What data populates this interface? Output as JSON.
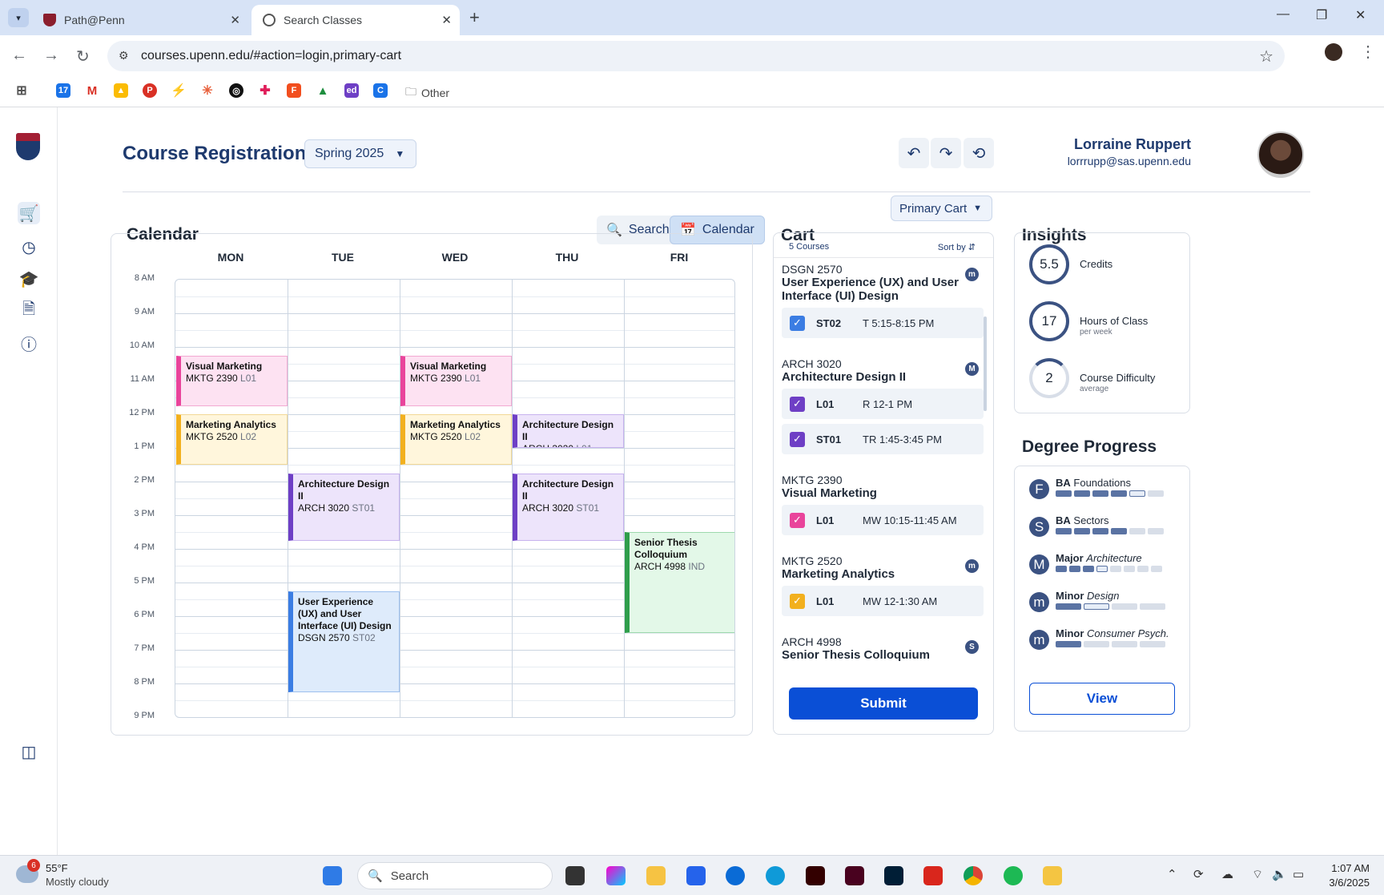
{
  "browser": {
    "tabs": [
      {
        "title": "Path@Penn"
      },
      {
        "title": "Search Classes"
      }
    ],
    "url": "courses.upenn.edu/#action=login,primary-cart",
    "bookmarks_folder": "Other"
  },
  "header": {
    "title": "Course Registration",
    "term": "Spring 2025",
    "user_name": "Lorraine Ruppert",
    "user_email": "lorrrupp@sas.upenn.edu"
  },
  "calendar": {
    "title": "Calendar",
    "search_label": "Search",
    "calendar_label": "Calendar",
    "days": [
      "MON",
      "TUE",
      "WED",
      "THU",
      "FRI"
    ],
    "hours": [
      "8 AM",
      "9 AM",
      "10 AM",
      "11 AM",
      "12 PM",
      "1 PM",
      "2 PM",
      "3 PM",
      "4 PM",
      "5 PM",
      "6 PM",
      "7 PM",
      "8 PM",
      "9 PM"
    ],
    "events": [
      {
        "title": "Visual Marketing",
        "code": "MKTG 2390",
        "section": "L01",
        "day": 0,
        "start": 10.25,
        "end": 11.75,
        "color": "pink"
      },
      {
        "title": "Visual Marketing",
        "code": "MKTG 2390",
        "section": "L01",
        "day": 2,
        "start": 10.25,
        "end": 11.75,
        "color": "pink"
      },
      {
        "title": "Marketing Analytics",
        "code": "MKTG 2520",
        "section": "L02",
        "day": 0,
        "start": 12,
        "end": 13.5,
        "color": "yellow"
      },
      {
        "title": "Marketing Analytics",
        "code": "MKTG 2520",
        "section": "L02",
        "day": 2,
        "start": 12,
        "end": 13.5,
        "color": "yellow"
      },
      {
        "title": "Architecture Design II",
        "code": "ARCH 3020",
        "section": "L01",
        "day": 3,
        "start": 12,
        "end": 13,
        "color": "purple"
      },
      {
        "title": "Architecture Design II",
        "code": "ARCH 3020",
        "section": "ST01",
        "day": 1,
        "start": 13.75,
        "end": 15.75,
        "color": "purple"
      },
      {
        "title": "Architecture Design II",
        "code": "ARCH 3020",
        "section": "ST01",
        "day": 3,
        "start": 13.75,
        "end": 15.75,
        "color": "purple"
      },
      {
        "title": "Senior Thesis Colloquium",
        "code": "ARCH 4998",
        "section": "IND",
        "day": 4,
        "start": 15.5,
        "end": 18.5,
        "color": "green"
      },
      {
        "title": "User Experience (UX) and User Interface (UI) Design",
        "code": "DSGN 2570",
        "section": "ST02",
        "day": 1,
        "start": 17.25,
        "end": 20.25,
        "color": "blue"
      }
    ]
  },
  "cart": {
    "title": "Cart",
    "cart_name": "Primary Cart",
    "count_label": "5 Courses",
    "sort_label": "Sort by",
    "submit_label": "Submit",
    "courses": [
      {
        "code": "DSGN 2570",
        "name": "User Experience (UX) and User Interface (UI) Design",
        "badge": "m",
        "sections": [
          {
            "id": "ST02",
            "time": "T 5:15-8:15 PM",
            "color": "#3b7de3"
          }
        ]
      },
      {
        "code": "ARCH 3020",
        "name": "Architecture Design II",
        "badge": "M",
        "sections": [
          {
            "id": "L01",
            "time": "R 12-1 PM",
            "color": "#6e3fc5"
          },
          {
            "id": "ST01",
            "time": "TR 1:45-3:45 PM",
            "color": "#6e3fc5"
          }
        ]
      },
      {
        "code": "MKTG 2390",
        "name": "Visual Marketing",
        "badge": "",
        "sections": [
          {
            "id": "L01",
            "time": "MW 10:15-11:45 AM",
            "color": "#e9449b"
          }
        ]
      },
      {
        "code": "MKTG 2520",
        "name": "Marketing Analytics",
        "badge": "m",
        "sections": [
          {
            "id": "L01",
            "time": "MW 12-1:30 AM",
            "color": "#f2b01e"
          }
        ]
      },
      {
        "code": "ARCH 4998",
        "name": "Senior Thesis Colloquium",
        "badge": "S",
        "sections": []
      }
    ]
  },
  "insights": {
    "title": "Insights",
    "items": [
      {
        "value": "5.5",
        "label": "Credits",
        "sub": ""
      },
      {
        "value": "17",
        "label": "Hours of Class",
        "sub": "per week"
      },
      {
        "value": "2",
        "label": "Course Difficulty",
        "sub": "average"
      }
    ]
  },
  "degree_progress": {
    "title": "Degree Progress",
    "view_label": "View",
    "items": [
      {
        "letter": "F",
        "bold": "BA",
        "rest": "Foundations",
        "italic": false,
        "filled": 4,
        "current": 1,
        "total": 6
      },
      {
        "letter": "S",
        "bold": "BA",
        "rest": "Sectors",
        "italic": false,
        "filled": 4,
        "current": 0,
        "total": 6
      },
      {
        "letter": "M",
        "bold": "Major",
        "rest": "Architecture",
        "italic": true,
        "filled": 3,
        "current": 1,
        "total": 8
      },
      {
        "letter": "m",
        "bold": "Minor",
        "rest": "Design",
        "italic": true,
        "filled": 1,
        "current": 1,
        "total": 4
      },
      {
        "letter": "m",
        "bold": "Minor",
        "rest": "Consumer Psych.",
        "italic": true,
        "filled": 1,
        "current": 0,
        "total": 4
      }
    ]
  },
  "taskbar": {
    "weather_temp": "55°F",
    "weather_desc": "Mostly cloudy",
    "weather_badge": "6",
    "search_label": "Search",
    "time": "1:07 AM",
    "date": "3/6/2025"
  }
}
